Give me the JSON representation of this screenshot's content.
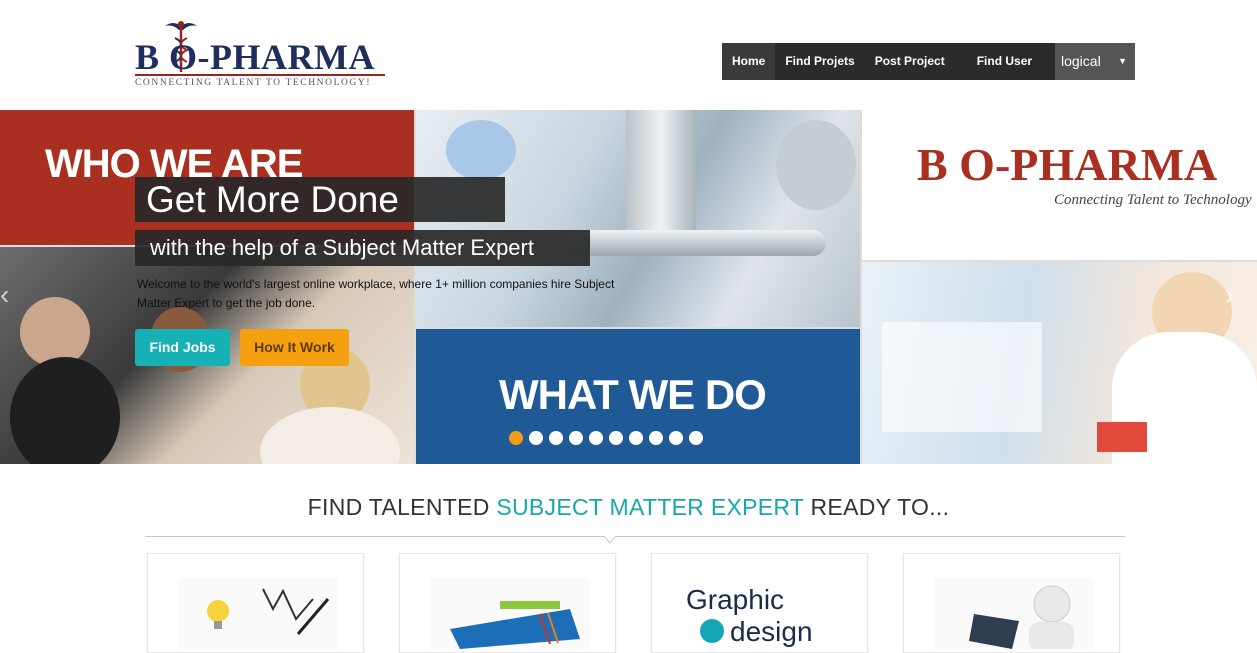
{
  "brand": {
    "name": "B  O-PHARMA",
    "tagline": "CONNECTING TALENT TO TECHNOLOGY!"
  },
  "nav": {
    "items": [
      "Home",
      "Find Projets",
      "Post Project",
      "Find User"
    ],
    "user": "logical"
  },
  "hero": {
    "banner_who": "WHO WE ARE",
    "banner_what": "WHAT WE DO",
    "banner_logo": "B  O-PHARMA",
    "banner_logo_sub": "Connecting Talent to Technology",
    "headline": "Get More Done",
    "subheadline": "with the help of a Subject Matter Expert",
    "description": "Welcome to the world's largest online workplace, where 1+ million companies hire Subject Matter Expert to get the job done.",
    "btn_jobs": "Find Jobs",
    "btn_how": "How It Work",
    "slide_count": 10,
    "active_slide": 1
  },
  "section": {
    "title_pre": "FIND TALENTED ",
    "title_accent": "SUBJECT MATTER EXPERT",
    "title_post": " READY TO..."
  },
  "cards": [
    {
      "icon": "idea-sketch-icon"
    },
    {
      "icon": "books-tablet-icon"
    },
    {
      "icon": "graphic-design-icon",
      "label": "Graphic design"
    },
    {
      "icon": "laptop-person-icon"
    }
  ],
  "colors": {
    "brand_navy": "#1e2f5e",
    "brand_red": "#a92f21",
    "accent_teal": "#15a8ac",
    "accent_orange": "#f5a011",
    "nav_bg": "#2b2b2b",
    "what_blue": "#1f5a96"
  }
}
